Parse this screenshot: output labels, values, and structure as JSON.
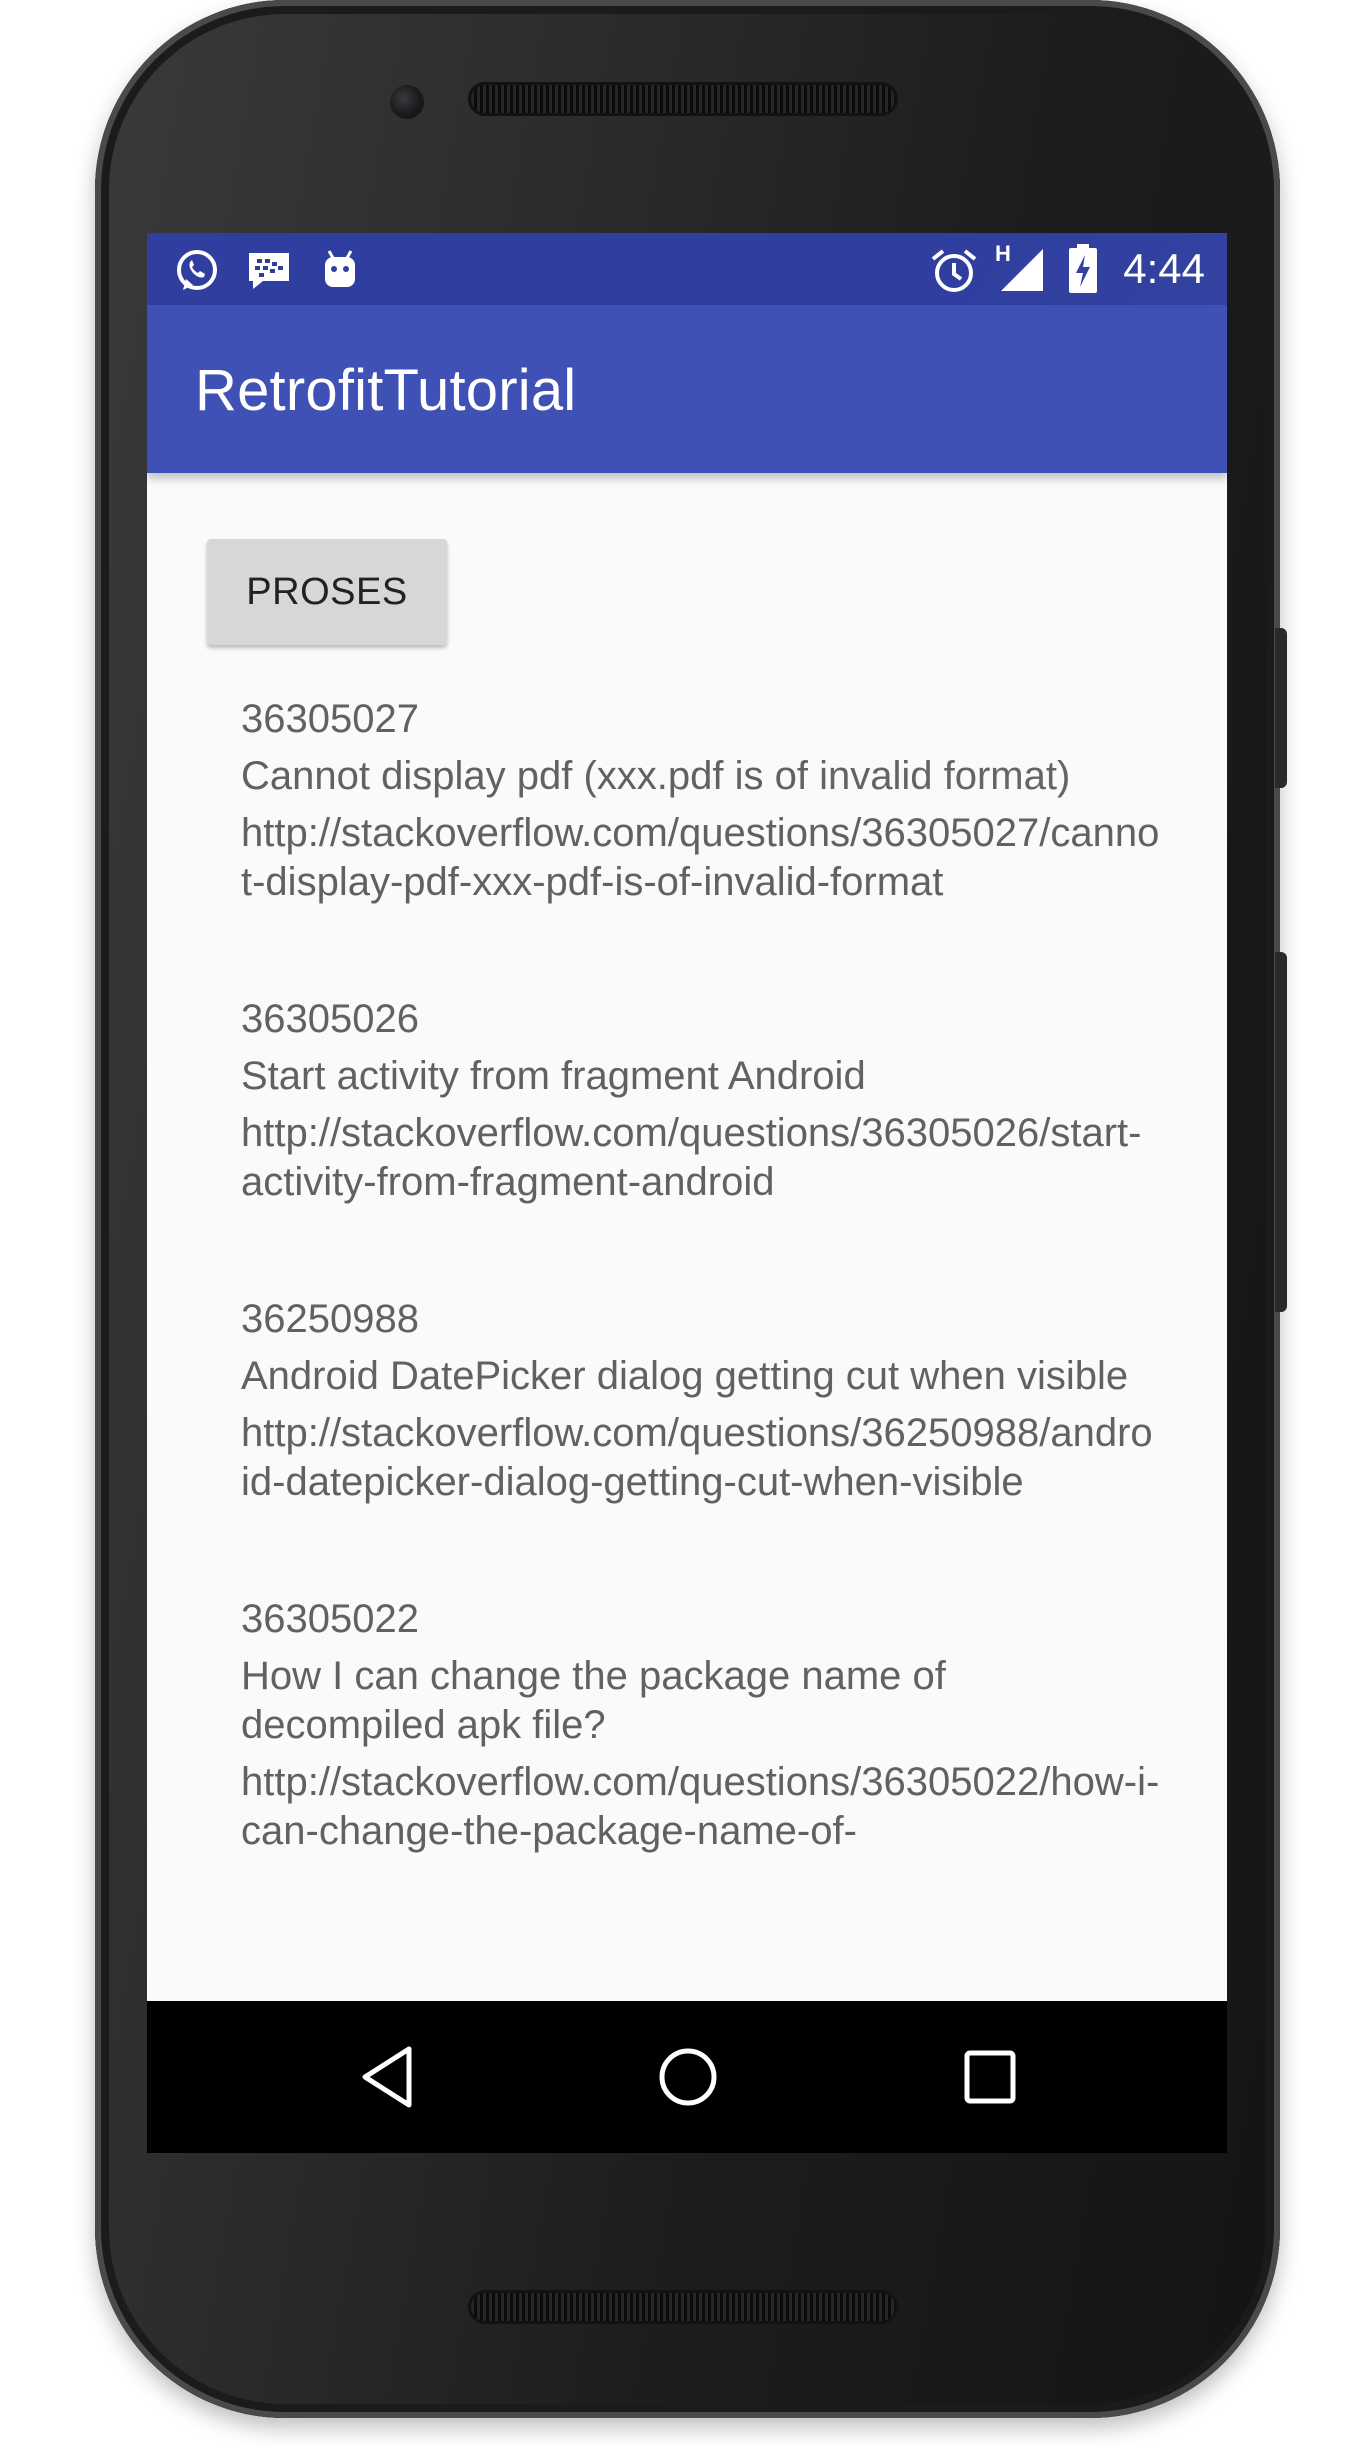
{
  "status_bar": {
    "time": "4:44",
    "network_label": "H",
    "left_icons": [
      "whatsapp-icon",
      "bbm-icon",
      "android-debug-icon"
    ],
    "right_icons": [
      "alarm-icon",
      "signal-icon",
      "battery-charging-icon"
    ]
  },
  "app_bar": {
    "title": "RetrofitTutorial"
  },
  "actions": {
    "proses_label": "PROSES"
  },
  "questions": [
    {
      "id": "36305027",
      "title": "Cannot display pdf (xxx.pdf is of invalid format)",
      "link": "http://stackoverflow.com/questions/36305027/cannot-display-pdf-xxx-pdf-is-of-invalid-format"
    },
    {
      "id": "36305026",
      "title": "Start activity from fragment Android",
      "link": "http://stackoverflow.com/questions/36305026/start-activity-from-fragment-android"
    },
    {
      "id": "36250988",
      "title": "Android DatePicker dialog getting cut when visible",
      "link": "http://stackoverflow.com/questions/36250988/android-datepicker-dialog-getting-cut-when-visible"
    },
    {
      "id": "36305022",
      "title": "How I can change the package name of decompiled apk file?",
      "link": "http://stackoverflow.com/questions/36305022/how-i-can-change-the-package-name-of-"
    }
  ],
  "nav_bar": {
    "icons": [
      "back-icon",
      "home-icon",
      "recents-icon"
    ]
  },
  "colors": {
    "status_bar": "#303f9f",
    "app_bar": "#3f51b5",
    "background": "#fafafa",
    "button": "#d6d7d7",
    "text": "#616161"
  }
}
